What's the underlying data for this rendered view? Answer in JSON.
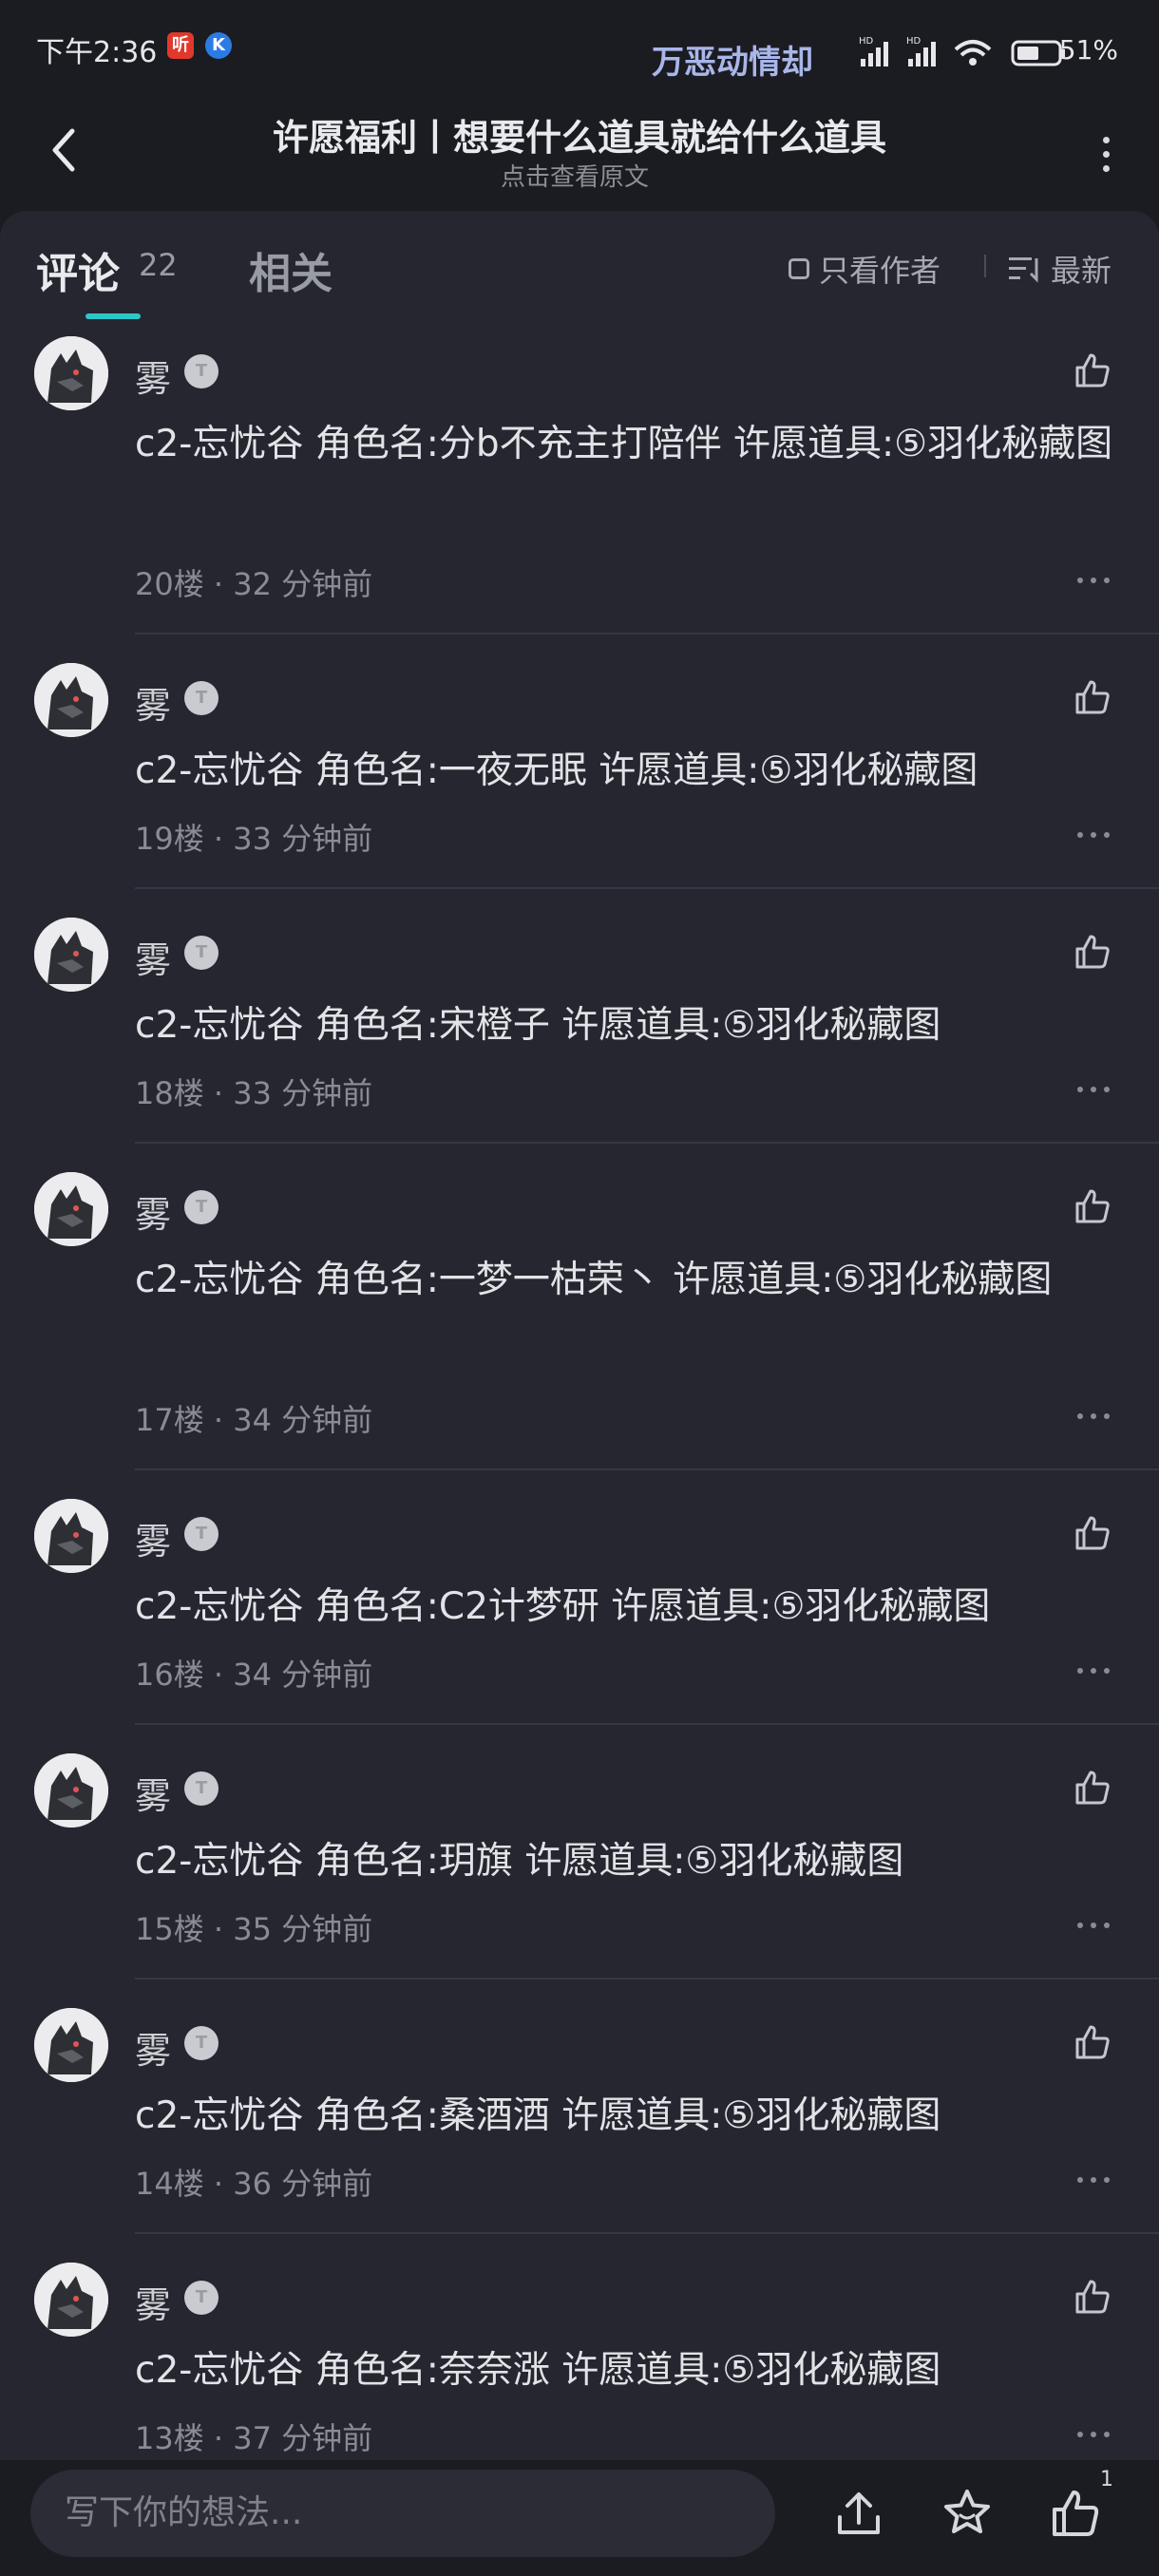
{
  "status": {
    "time": "下午2:36",
    "scroll_text": "万恶动情却",
    "battery": "51%"
  },
  "header": {
    "title": "许愿福利丨想要什么道具就给什么道具",
    "subtitle": "点击查看原文"
  },
  "tabs": {
    "comments": "评论",
    "comment_count": "22",
    "related": "相关",
    "author_only": "只看作者",
    "sort": "最新"
  },
  "comments": [
    {
      "user": "雾",
      "text": "c2-忘忧谷 角色名:分b不充主打陪伴 许愿道具:⑤羽化秘藏图",
      "floor": "20楼",
      "time": "32 分钟前"
    },
    {
      "user": "雾",
      "text": "c2-忘忧谷 角色名:一夜无眠 许愿道具:⑤羽化秘藏图",
      "floor": "19楼",
      "time": "33 分钟前"
    },
    {
      "user": "雾",
      "text": "c2-忘忧谷 角色名:宋橙子 许愿道具:⑤羽化秘藏图",
      "floor": "18楼",
      "time": "33 分钟前"
    },
    {
      "user": "雾",
      "text": "c2-忘忧谷 角色名:一梦一枯荣丶 许愿道具:⑤羽化秘藏图",
      "floor": "17楼",
      "time": "34 分钟前"
    },
    {
      "user": "雾",
      "text": "c2-忘忧谷 角色名:C2计梦研 许愿道具:⑤羽化秘藏图",
      "floor": "16楼",
      "time": "34 分钟前"
    },
    {
      "user": "雾",
      "text": "c2-忘忧谷 角色名:玥旗 许愿道具:⑤羽化秘藏图",
      "floor": "15楼",
      "time": "35 分钟前"
    },
    {
      "user": "雾",
      "text": "c2-忘忧谷 角色名:桑酒酒 许愿道具:⑤羽化秘藏图",
      "floor": "14楼",
      "time": "36 分钟前"
    },
    {
      "user": "雾",
      "text": "c2-忘忧谷 角色名:奈奈涨 许愿道具:⑤羽化秘藏图",
      "floor": "13楼",
      "time": "37 分钟前"
    }
  ],
  "bottom": {
    "placeholder": "写下你的想法...",
    "like_count": "1"
  },
  "colors": {
    "background": "#1b1c22",
    "panel": "#25262f",
    "accent": "#2cc8c8"
  }
}
